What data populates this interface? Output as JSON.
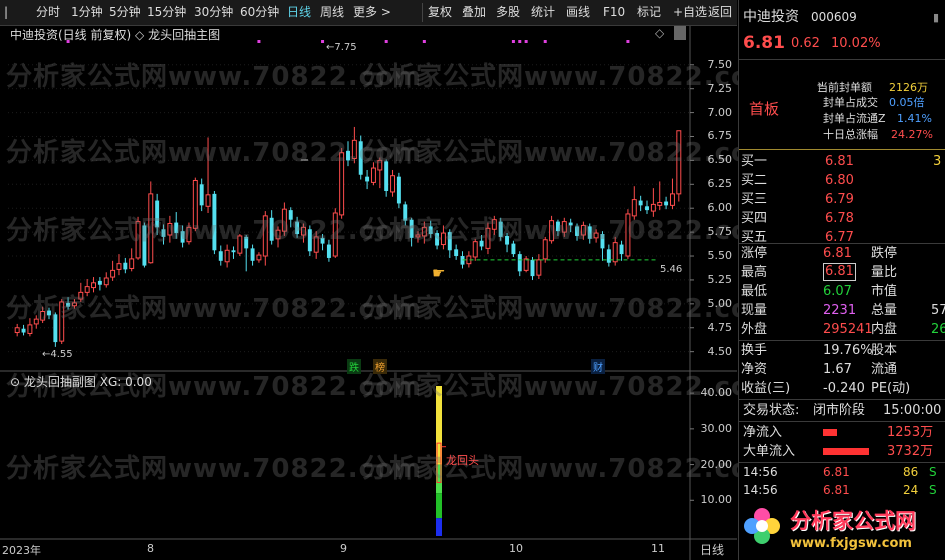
{
  "toolbar": {
    "left_items": [
      "分时",
      "1分钟",
      "5分钟",
      "15分钟",
      "30分钟",
      "60分钟",
      "日线",
      "周线",
      "更多 >"
    ],
    "active": "日线",
    "right_items": [
      "复权",
      "叠加",
      "多股",
      "统计",
      "画线",
      "F10",
      "标记",
      "+自选",
      "返回"
    ]
  },
  "main_chart": {
    "title": "中迪投资(日线 前复权)",
    "indicator_title": "龙头回抽主图",
    "y_ticks": [
      "7.50",
      "7.25",
      "7.00",
      "6.75",
      "6.50",
      "6.25",
      "6.00",
      "5.75",
      "5.50",
      "5.25",
      "5.00",
      "4.75",
      "4.50"
    ],
    "high_label": "7.75",
    "low_label": "4.55",
    "line_value_label": "5.46",
    "markers": [
      {
        "text": "跌",
        "color": "#22d03a"
      },
      {
        "text": "榜",
        "color": "#f0a030"
      },
      {
        "text": "财",
        "color": "#4fa0ff"
      }
    ]
  },
  "sub_chart": {
    "title": "龙头回抽副图",
    "param": "XG: 0.00",
    "y_ticks": [
      "40.00",
      "30.00",
      "20.00",
      "10.00"
    ],
    "signal_label": "龙回头"
  },
  "x_axis": {
    "labels": [
      "2023年",
      "8",
      "9",
      "10",
      "11"
    ],
    "period": "日线"
  },
  "watermark": "分析家公式网www.70822.com",
  "logo": {
    "text": "分析家公式网",
    "url": "www.fxjgsw.com"
  },
  "stock": {
    "name": "中迪投资",
    "code": "000609",
    "price": "6.81",
    "change": "0.62",
    "change_pct": "10.02%",
    "board": "首板",
    "seal_info": [
      {
        "label": "当前封单额",
        "value": "2126万"
      },
      {
        "label": "封单占成交",
        "value": "0.05倍"
      },
      {
        "label": "封单占流通Z",
        "value": "1.41%"
      },
      {
        "label": "十日总涨幅",
        "value": "24.27%"
      }
    ]
  },
  "order_book": [
    {
      "label": "买一",
      "price": "6.81",
      "vol": "3"
    },
    {
      "label": "买二",
      "price": "6.80",
      "vol": ""
    },
    {
      "label": "买三",
      "price": "6.79",
      "vol": ""
    },
    {
      "label": "买四",
      "price": "6.78",
      "vol": ""
    },
    {
      "label": "买五",
      "price": "6.77",
      "vol": ""
    }
  ],
  "quote": [
    {
      "l1": "涨停",
      "v1": "6.81",
      "l2": "跌停",
      "v2": "",
      "c": "red"
    },
    {
      "l1": "最高",
      "v1": "6.81",
      "l2": "量比",
      "v2": "",
      "c": "red"
    },
    {
      "l1": "最低",
      "v1": "6.07",
      "l2": "市值",
      "v2": "",
      "c": "green"
    },
    {
      "l1": "现量",
      "v1": "2231",
      "l2": "总量",
      "v2": "57",
      "c": "purple"
    },
    {
      "l1": "外盘",
      "v1": "295241",
      "l2": "内盘",
      "v2": "26",
      "c": "red"
    }
  ],
  "quote2": [
    {
      "l1": "换手",
      "v1": "19.76%",
      "l2": "股本",
      "v2": ""
    },
    {
      "l1": "净资",
      "v1": "1.67",
      "l2": "流通",
      "v2": ""
    },
    {
      "l1": "收益(三)",
      "v1": "-0.240",
      "l2": "PE(动)",
      "v2": ""
    }
  ],
  "trade_status": {
    "label": "交易状态:",
    "status": "闭市阶段",
    "time": "15:00:00"
  },
  "flows": [
    {
      "label": "净流入",
      "value": "1253万",
      "bar": 0.3
    },
    {
      "label": "大单流入",
      "value": "3732万",
      "bar": 0.95
    }
  ],
  "ticks": [
    {
      "time": "14:56",
      "price": "6.81",
      "vol": "86",
      "side": "S"
    },
    {
      "time": "14:56",
      "price": "6.81",
      "vol": "24",
      "side": "S"
    }
  ],
  "candles": [
    [
      4.7,
      4.75,
      4.66,
      4.79
    ],
    [
      4.74,
      4.7,
      4.67,
      4.78
    ],
    [
      4.69,
      4.78,
      4.66,
      4.85
    ],
    [
      4.79,
      4.84,
      4.74,
      4.88
    ],
    [
      4.83,
      4.92,
      4.8,
      4.97
    ],
    [
      4.93,
      4.88,
      4.84,
      4.96
    ],
    [
      4.89,
      4.6,
      4.55,
      4.91
    ],
    [
      4.61,
      5.02,
      4.58,
      5.05
    ],
    [
      5.01,
      4.97,
      4.94,
      5.07
    ],
    [
      4.98,
      5.01,
      4.95,
      5.05
    ],
    [
      5.05,
      5.12,
      5.02,
      5.22
    ],
    [
      5.12,
      5.18,
      5.08,
      5.26
    ],
    [
      5.17,
      5.22,
      5.12,
      5.28
    ],
    [
      5.24,
      5.2,
      5.14,
      5.28
    ],
    [
      5.2,
      5.27,
      5.17,
      5.33
    ],
    [
      5.28,
      5.35,
      5.24,
      5.45
    ],
    [
      5.36,
      5.42,
      5.3,
      5.52
    ],
    [
      5.43,
      5.36,
      5.32,
      5.48
    ],
    [
      5.37,
      5.47,
      5.34,
      5.58
    ],
    [
      5.48,
      5.86,
      5.46,
      5.91
    ],
    [
      5.82,
      5.4,
      5.38,
      5.85
    ],
    [
      5.43,
      6.15,
      5.42,
      6.28
    ],
    [
      6.08,
      5.8,
      5.72,
      6.15
    ],
    [
      5.78,
      5.7,
      5.62,
      5.83
    ],
    [
      5.72,
      5.84,
      5.64,
      5.92
    ],
    [
      5.85,
      5.74,
      5.68,
      5.96
    ],
    [
      5.76,
      5.64,
      5.59,
      5.82
    ],
    [
      5.65,
      5.8,
      5.62,
      5.85
    ],
    [
      5.79,
      6.29,
      5.76,
      6.32
    ],
    [
      6.25,
      6.03,
      5.97,
      6.31
    ],
    [
      6.02,
      6.14,
      5.95,
      6.74
    ],
    [
      6.15,
      5.56,
      5.52,
      6.18
    ],
    [
      5.55,
      5.45,
      5.4,
      5.61
    ],
    [
      5.44,
      5.56,
      5.38,
      5.62
    ],
    [
      5.56,
      5.54,
      5.47,
      5.6
    ],
    [
      5.53,
      5.71,
      5.5,
      5.73
    ],
    [
      5.7,
      5.58,
      5.34,
      5.72
    ],
    [
      5.58,
      5.45,
      5.4,
      5.62
    ],
    [
      5.46,
      5.51,
      5.43,
      5.54
    ],
    [
      5.5,
      5.92,
      5.4,
      5.97
    ],
    [
      5.9,
      5.66,
      5.62,
      5.98
    ],
    [
      5.68,
      5.77,
      5.59,
      5.81
    ],
    [
      5.76,
      5.99,
      5.71,
      6.06
    ],
    [
      5.98,
      5.88,
      5.8,
      6.01
    ],
    [
      5.86,
      5.73,
      5.69,
      5.91
    ],
    [
      5.72,
      5.8,
      5.64,
      5.84
    ],
    [
      5.78,
      5.55,
      5.5,
      5.82
    ],
    [
      5.54,
      5.7,
      5.47,
      5.76
    ],
    [
      5.69,
      5.63,
      5.56,
      5.73
    ],
    [
      5.62,
      5.48,
      5.44,
      5.67
    ],
    [
      5.5,
      5.95,
      5.48,
      6.0
    ],
    [
      5.93,
      6.58,
      5.89,
      6.63
    ],
    [
      6.6,
      6.5,
      6.44,
      6.7
    ],
    [
      6.52,
      6.71,
      6.47,
      6.85
    ],
    [
      6.7,
      6.35,
      6.3,
      6.76
    ],
    [
      6.33,
      6.28,
      6.2,
      6.4
    ],
    [
      6.27,
      6.42,
      6.24,
      6.48
    ],
    [
      6.4,
      6.5,
      6.21,
      6.53
    ],
    [
      6.49,
      6.18,
      6.12,
      6.51
    ],
    [
      6.17,
      6.34,
      6.12,
      6.4
    ],
    [
      6.33,
      6.05,
      6.0,
      6.37
    ],
    [
      6.04,
      5.87,
      5.82,
      6.07
    ],
    [
      5.88,
      5.69,
      5.6,
      5.9
    ],
    [
      5.7,
      5.72,
      5.64,
      5.76
    ],
    [
      5.71,
      5.8,
      5.63,
      5.86
    ],
    [
      5.81,
      5.73,
      5.69,
      5.87
    ],
    [
      5.74,
      5.61,
      5.57,
      5.77
    ],
    [
      5.62,
      5.74,
      5.57,
      5.82
    ],
    [
      5.75,
      5.56,
      5.48,
      5.78
    ],
    [
      5.57,
      5.5,
      5.46,
      5.62
    ],
    [
      5.5,
      5.41,
      5.37,
      5.55
    ],
    [
      5.42,
      5.5,
      5.38,
      5.55
    ],
    [
      5.49,
      5.65,
      5.45,
      5.68
    ],
    [
      5.66,
      5.6,
      5.56,
      5.72
    ],
    [
      5.58,
      5.79,
      5.52,
      5.85
    ],
    [
      5.78,
      5.88,
      5.72,
      5.92
    ],
    [
      5.86,
      5.7,
      5.66,
      5.9
    ],
    [
      5.71,
      5.62,
      5.54,
      5.74
    ],
    [
      5.63,
      5.52,
      5.49,
      5.66
    ],
    [
      5.52,
      5.34,
      5.29,
      5.55
    ],
    [
      5.35,
      5.47,
      5.33,
      5.5
    ],
    [
      5.46,
      5.29,
      5.25,
      5.49
    ],
    [
      5.3,
      5.46,
      5.26,
      5.52
    ],
    [
      5.47,
      5.67,
      5.43,
      5.7
    ],
    [
      5.66,
      5.87,
      5.63,
      5.92
    ],
    [
      5.86,
      5.76,
      5.71,
      5.88
    ],
    [
      5.75,
      5.86,
      5.7,
      5.9
    ],
    [
      5.85,
      5.82,
      5.75,
      5.89
    ],
    [
      5.81,
      5.71,
      5.66,
      5.84
    ],
    [
      5.72,
      5.82,
      5.67,
      5.86
    ],
    [
      5.81,
      5.68,
      5.63,
      5.84
    ],
    [
      5.69,
      5.74,
      5.64,
      5.78
    ],
    [
      5.73,
      5.58,
      5.45,
      5.76
    ],
    [
      5.57,
      5.43,
      5.39,
      5.62
    ],
    [
      5.44,
      5.64,
      5.4,
      5.7
    ],
    [
      5.62,
      5.52,
      5.45,
      5.66
    ],
    [
      5.5,
      5.94,
      5.47,
      5.99
    ],
    [
      5.92,
      6.09,
      5.88,
      6.23
    ],
    [
      6.08,
      6.03,
      5.97,
      6.13
    ],
    [
      6.02,
      5.98,
      5.94,
      6.08
    ],
    [
      5.97,
      6.04,
      5.91,
      6.21
    ],
    [
      6.03,
      6.06,
      5.98,
      6.28
    ],
    [
      6.07,
      6.03,
      5.99,
      6.12
    ],
    [
      6.03,
      6.15,
      5.99,
      6.31
    ],
    [
      6.15,
      6.81,
      6.07,
      6.81
    ]
  ]
}
